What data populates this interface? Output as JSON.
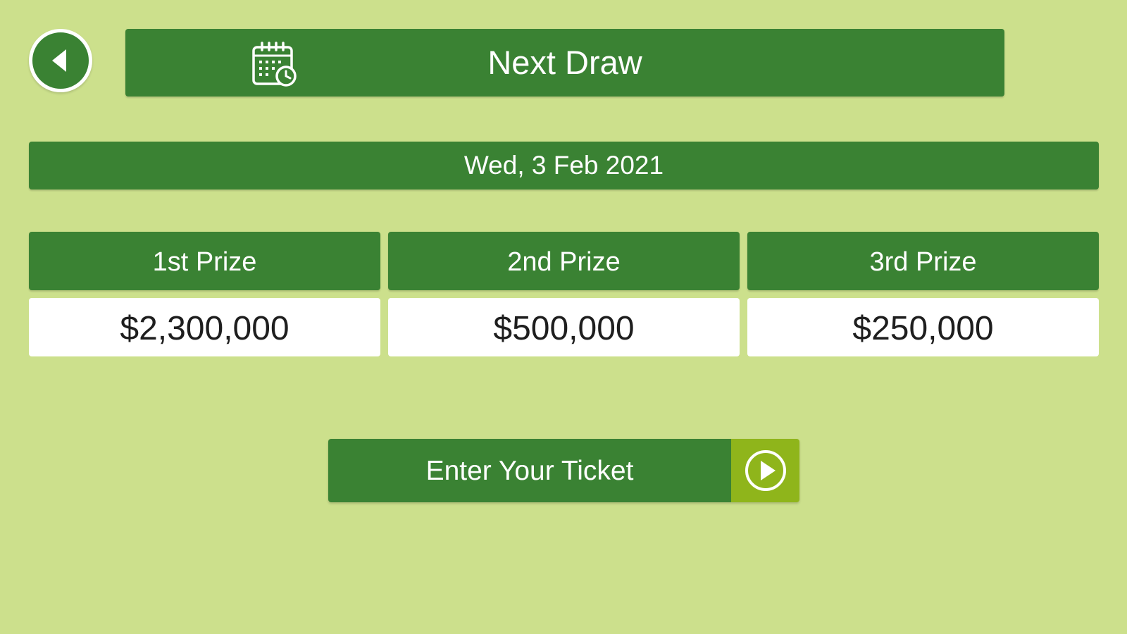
{
  "colors": {
    "background": "#cce08c",
    "primary_green": "#3a8233",
    "accent_lime": "#8fb51b",
    "white": "#ffffff"
  },
  "header": {
    "back_icon": "back-arrow-icon",
    "calendar_icon": "calendar-clock-icon",
    "title": "Next Draw"
  },
  "draw_date": "Wed, 3 Feb 2021",
  "prizes": [
    {
      "label": "1st Prize",
      "amount": "$2,300,000"
    },
    {
      "label": "2nd Prize",
      "amount": "$500,000"
    },
    {
      "label": "3rd Prize",
      "amount": "$250,000"
    }
  ],
  "cta": {
    "label": "Enter Your Ticket",
    "icon": "play-circle-icon"
  }
}
